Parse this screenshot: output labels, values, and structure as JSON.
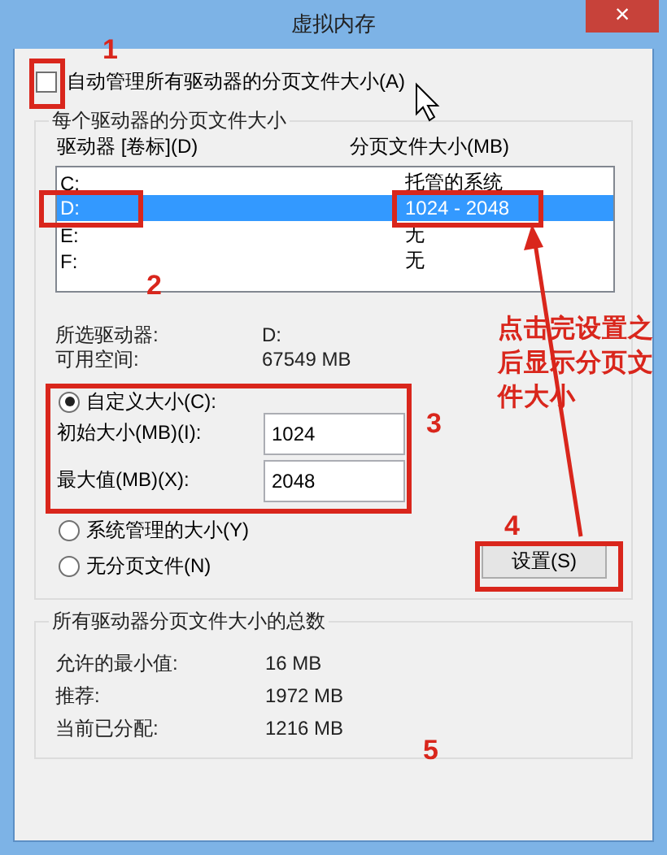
{
  "window": {
    "title": "虚拟内存",
    "close": "×"
  },
  "auto_manage": {
    "label": "自动管理所有驱动器的分页文件大小(A)",
    "checked": false
  },
  "per_drive": {
    "title": "每个驱动器的分页文件大小",
    "columns": [
      "驱动器 [卷标](D)",
      "分页文件大小(MB)"
    ],
    "rows": [
      {
        "drive": "C:",
        "size": "托管的系统",
        "selected": false
      },
      {
        "drive": "D:",
        "size": "1024 - 2048",
        "selected": true
      },
      {
        "drive": "E:",
        "size": "无",
        "selected": false
      },
      {
        "drive": "F:",
        "size": "无",
        "selected": false
      }
    ],
    "info": [
      {
        "label": "所选驱动器:",
        "value": "D:"
      },
      {
        "label": "可用空间:",
        "value": "67549 MB"
      }
    ],
    "options": [
      {
        "label": "自定义大小(C):",
        "selected": true,
        "fields": [
          {
            "label": "初始大小(MB)(I):",
            "value": "1024"
          },
          {
            "label": "最大值(MB)(X):",
            "value": "2048"
          }
        ]
      },
      {
        "label": "系统管理的大小(Y)",
        "selected": false
      },
      {
        "label": "无分页文件(N)",
        "selected": false
      }
    ],
    "set_button": "设置(S)"
  },
  "totals": {
    "title": "所有驱动器分页文件大小的总数",
    "rows": [
      {
        "label": "允许的最小值:",
        "value": "16 MB"
      },
      {
        "label": "推荐:",
        "value": "1972 MB"
      },
      {
        "label": "当前已分配:",
        "value": "1216 MB"
      }
    ]
  },
  "annotations": [
    {
      "kind": "number",
      "text": "1"
    },
    {
      "kind": "number",
      "text": "2"
    },
    {
      "kind": "number",
      "text": "3"
    },
    {
      "kind": "number",
      "text": "4"
    },
    {
      "kind": "number",
      "text": "5"
    },
    {
      "kind": "note",
      "text": "点击完设置之后显示分页文件大小"
    }
  ]
}
